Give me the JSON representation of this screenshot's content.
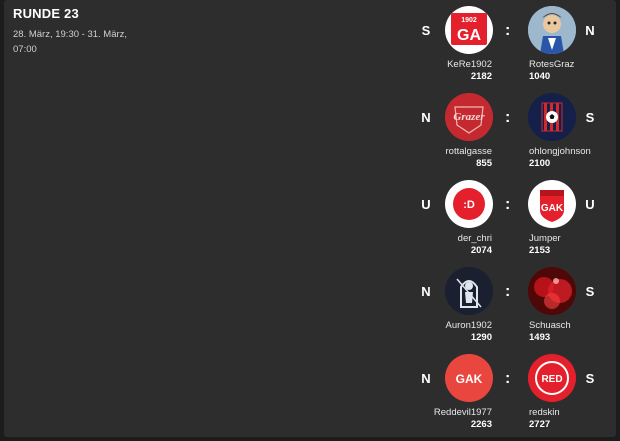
{
  "round": {
    "title": "RUNDE 23",
    "date": "28. März, 19:30 - 31. März, 07:00"
  },
  "matches": [
    {
      "left": {
        "result": "S",
        "name": "KeRe1902",
        "points": "2182",
        "avatar": "ga-1902-logo",
        "avatar_text": "GA",
        "avatar_small": "1902"
      },
      "right": {
        "result": "N",
        "name": "RotesGraz",
        "points": "1040",
        "avatar": "cartoon-avatar"
      }
    },
    {
      "left": {
        "result": "N",
        "name": "rottalgasse",
        "points": "855",
        "avatar": "grazer-ak-crest-avatar",
        "avatar_text": "Grazer"
      },
      "right": {
        "result": "S",
        "name": "ohlongjohnson",
        "points": "2100",
        "avatar": "soccer-ball-stripes-avatar"
      }
    },
    {
      "left": {
        "result": "U",
        "name": "der_chri",
        "points": "2074",
        "avatar": "smiley-avatar",
        "avatar_text": ":D"
      },
      "right": {
        "result": "U",
        "name": "Jumper",
        "points": "2153",
        "avatar": "gak-shield-avatar",
        "avatar_text": "GAK"
      }
    },
    {
      "left": {
        "result": "N",
        "name": "Auron1902",
        "points": "1290",
        "avatar": "knight-avatar"
      },
      "right": {
        "result": "S",
        "name": "Schuasch",
        "points": "1493",
        "avatar": "red-fans-avatar"
      }
    },
    {
      "left": {
        "result": "N",
        "name": "Reddevil1977",
        "points": "2263",
        "avatar": "gak-text-avatar",
        "avatar_text": "GAK"
      },
      "right": {
        "result": "S",
        "name": "redskin",
        "points": "2727",
        "avatar": "red-badge-avatar",
        "avatar_text": "RED"
      }
    }
  ],
  "separator": ":",
  "colors": {
    "panel": "#2d2d2d",
    "background": "#1c1c1c",
    "accent_red": "#e3202b",
    "text": "#ffffff"
  }
}
